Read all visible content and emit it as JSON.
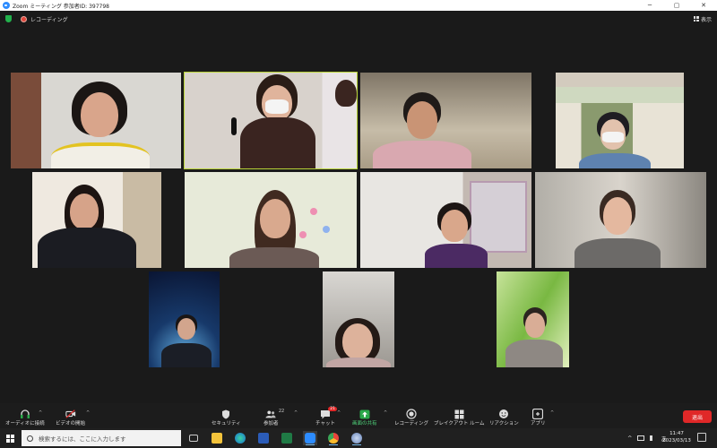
{
  "window": {
    "title": "Zoom ミーティング 参加者ID: 397798",
    "minimize_icon": "minimize-icon",
    "maximize_icon": "restore-icon",
    "close_icon": "close-icon",
    "min": "─",
    "max": "▢",
    "close": "✕"
  },
  "meeting_header": {
    "recording_label": "レコーディング",
    "view_label": "表示"
  },
  "toolbar": {
    "audio": "オーディオに接続",
    "video": "ビデオの開始",
    "security": "セキュリティ",
    "participants": "参加者",
    "participant_count": "22",
    "chat": "チャット",
    "chat_badge": "21",
    "share": "画面の共有",
    "record": "レコーディング",
    "breakout": "ブレイクアウト ルーム",
    "reactions": "リアクション",
    "apps": "アプリ",
    "end": "退出",
    "caret": "^"
  },
  "taskbar": {
    "search_placeholder": "検索するには、ここに入力します",
    "ime": "あ",
    "time": "11:47",
    "date": "2023/03/13",
    "tray_up": "^"
  },
  "colors": {
    "accent_green": "#b9d437",
    "end_red": "#e02828",
    "zoom_blue": "#2d8cff"
  }
}
